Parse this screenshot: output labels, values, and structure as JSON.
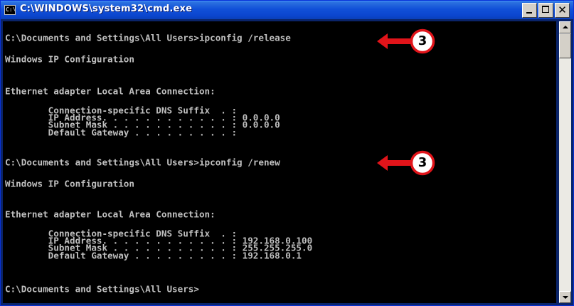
{
  "window": {
    "title": "C:\\WINDOWS\\system32\\cmd.exe",
    "icon_name": "console-app-icon",
    "icon_glyph": "C:\\",
    "controls": {
      "minimize_icon": "minimize-icon",
      "maximize_icon": "maximize-icon",
      "close_icon": "close-icon",
      "close_glyph": "✕"
    }
  },
  "console": {
    "lines": [
      "C:\\Documents and Settings\\All Users>ipconfig /release",
      "",
      "Windows IP Configuration",
      "",
      "",
      "Ethernet adapter Local Area Connection:",
      "",
      "        Connection-specific DNS Suffix  . :",
      "        IP Address. . . . . . . . . . . . : 0.0.0.0",
      "        Subnet Mask . . . . . . . . . . . : 0.0.0.0",
      "        Default Gateway . . . . . . . . . :",
      "",
      "C:\\Documents and Settings\\All Users>ipconfig /renew",
      "",
      "Windows IP Configuration",
      "",
      "",
      "Ethernet adapter Local Area Connection:",
      "",
      "        Connection-specific DNS Suffix  . :",
      "        IP Address. . . . . . . . . . . . : 192.168.0.100",
      "        Subnet Mask . . . . . . . . . . . : 255.255.255.0",
      "        Default Gateway . . . . . . . . . : 192.168.0.1",
      "",
      "C:\\Documents and Settings\\All Users>"
    ]
  },
  "callouts": [
    {
      "number": "3",
      "icon": "left-arrow-callout-icon"
    },
    {
      "number": "3",
      "icon": "left-arrow-callout-icon"
    }
  ],
  "colors": {
    "title_bar": "#0b46cf",
    "console_bg": "#000000",
    "console_text": "#c0c0c0",
    "callout_red": "#e1141a",
    "callout_fill": "#ffffff"
  }
}
